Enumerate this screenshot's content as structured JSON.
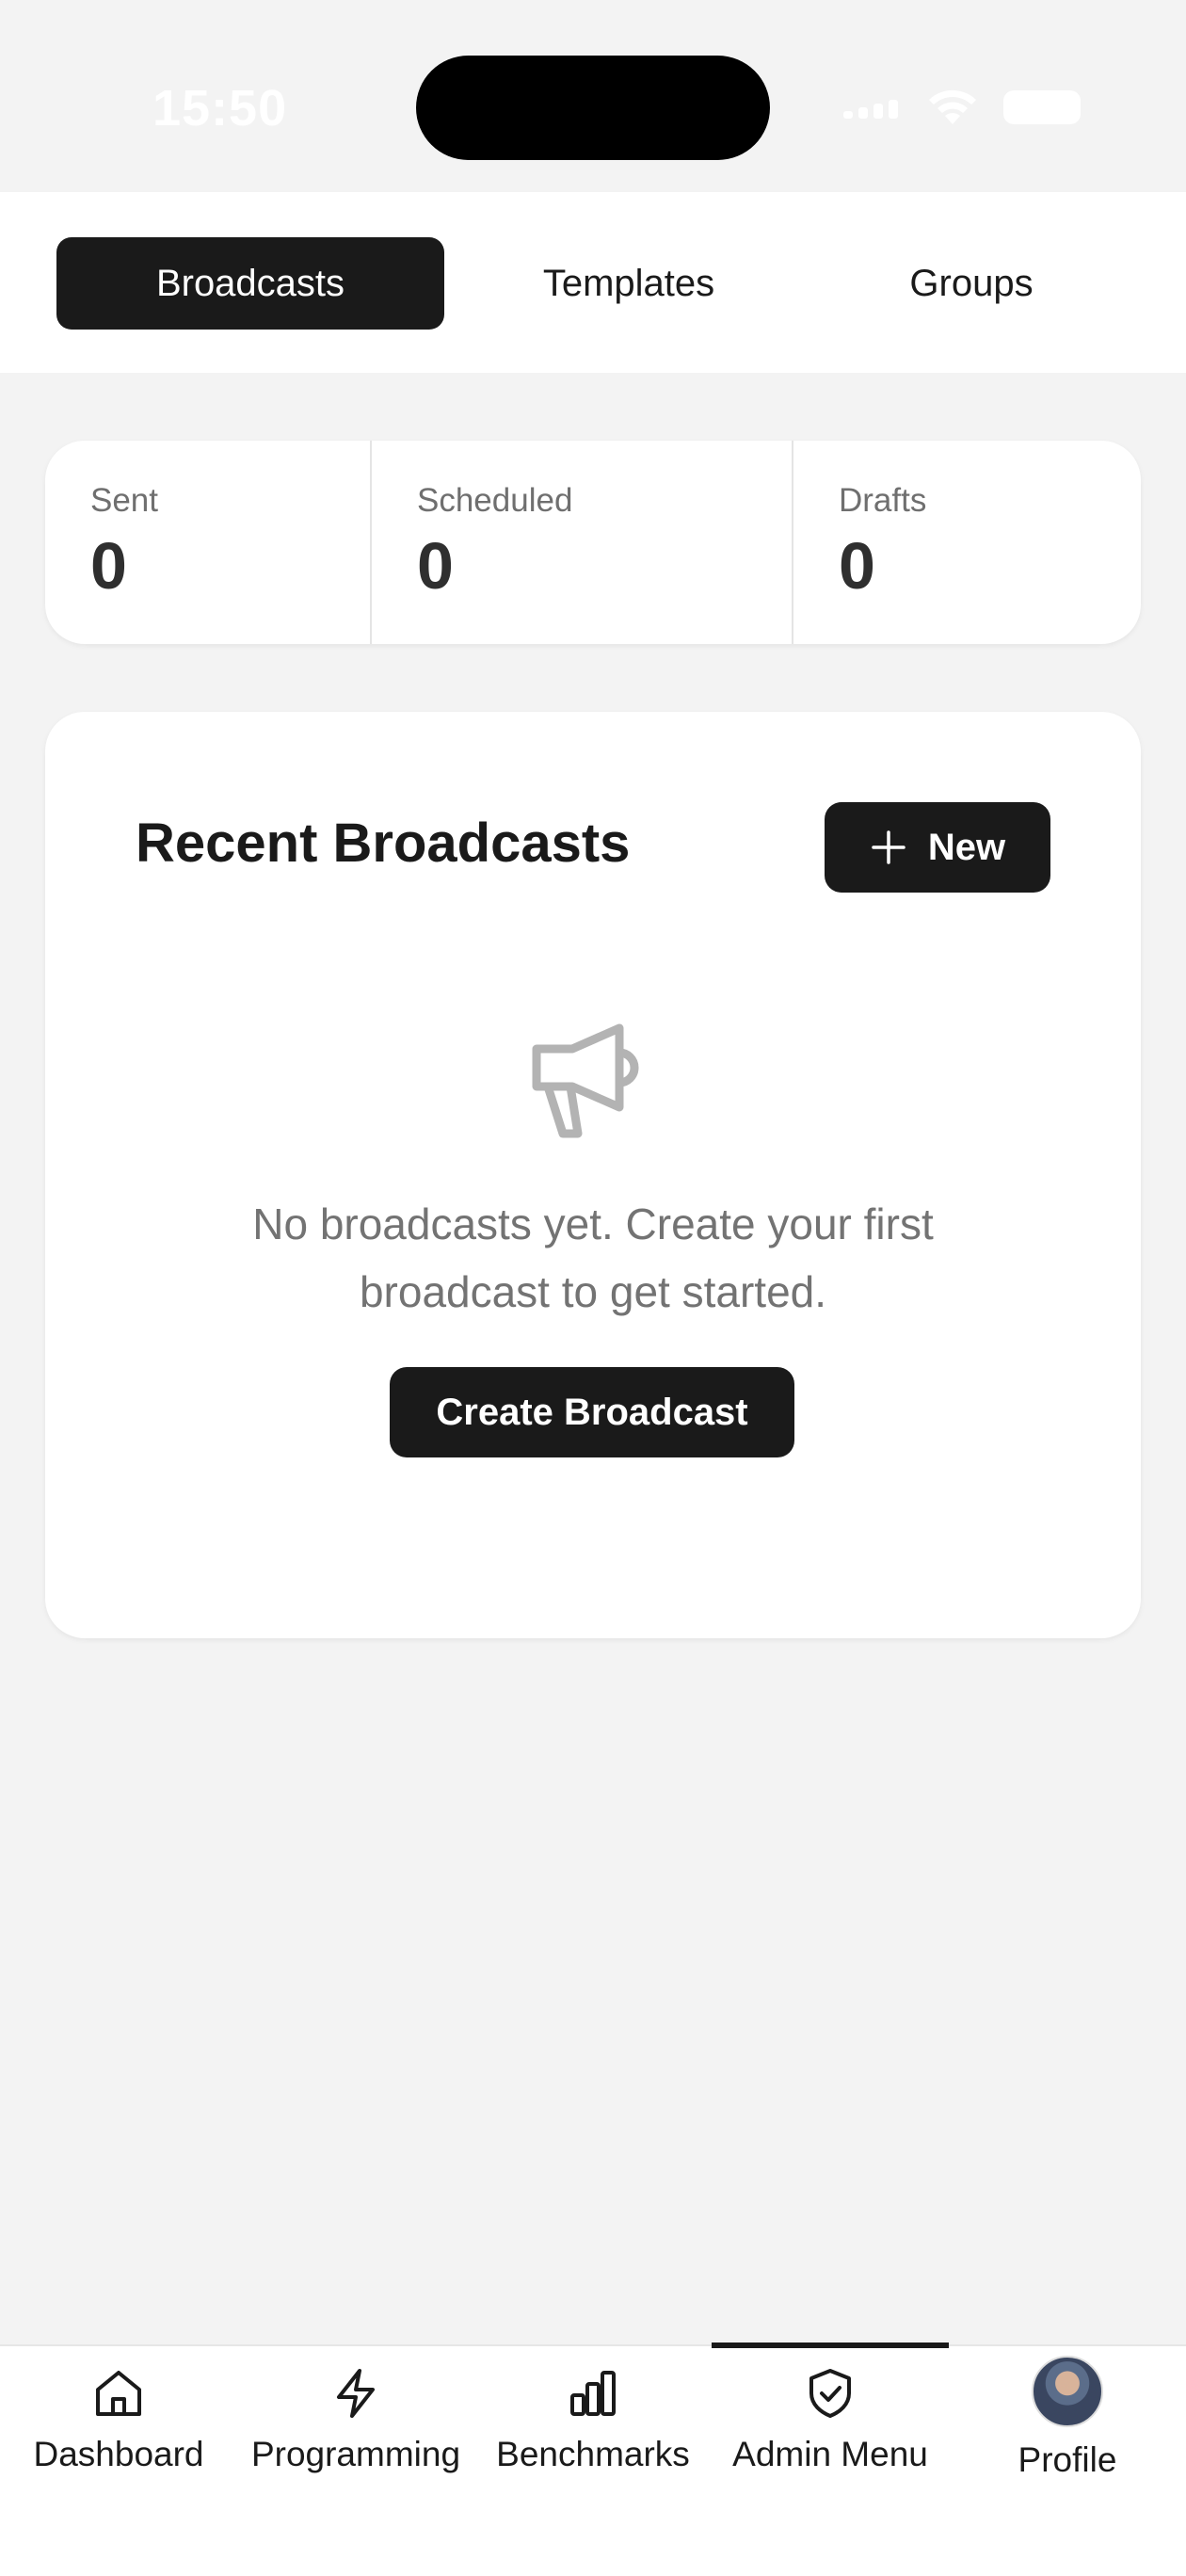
{
  "status_bar": {
    "time": "15:50"
  },
  "top_tabs": [
    {
      "label": "Broadcasts",
      "active": true
    },
    {
      "label": "Templates",
      "active": false
    },
    {
      "label": "Groups",
      "active": false
    }
  ],
  "stats": [
    {
      "label": "Sent",
      "value": "0"
    },
    {
      "label": "Scheduled",
      "value": "0"
    },
    {
      "label": "Drafts",
      "value": "0"
    }
  ],
  "recent": {
    "title": "Recent Broadcasts",
    "new_label": "New",
    "empty_icon": "megaphone-icon",
    "empty_text": "No broadcasts yet. Create your first broadcast to get started.",
    "create_label": "Create Broadcast"
  },
  "bottom_nav": [
    {
      "label": "Dashboard",
      "icon": "home-icon",
      "active": false
    },
    {
      "label": "Programming",
      "icon": "lightning-icon",
      "active": false
    },
    {
      "label": "Benchmarks",
      "icon": "bar-chart-icon",
      "active": false
    },
    {
      "label": "Admin Menu",
      "icon": "shield-check-icon",
      "active": true
    },
    {
      "label": "Profile",
      "icon": "avatar",
      "active": false
    }
  ],
  "colors": {
    "background": "#f3f3f3",
    "surface": "#ffffff",
    "primary": "#1a1a1a",
    "muted_text": "#737373"
  }
}
